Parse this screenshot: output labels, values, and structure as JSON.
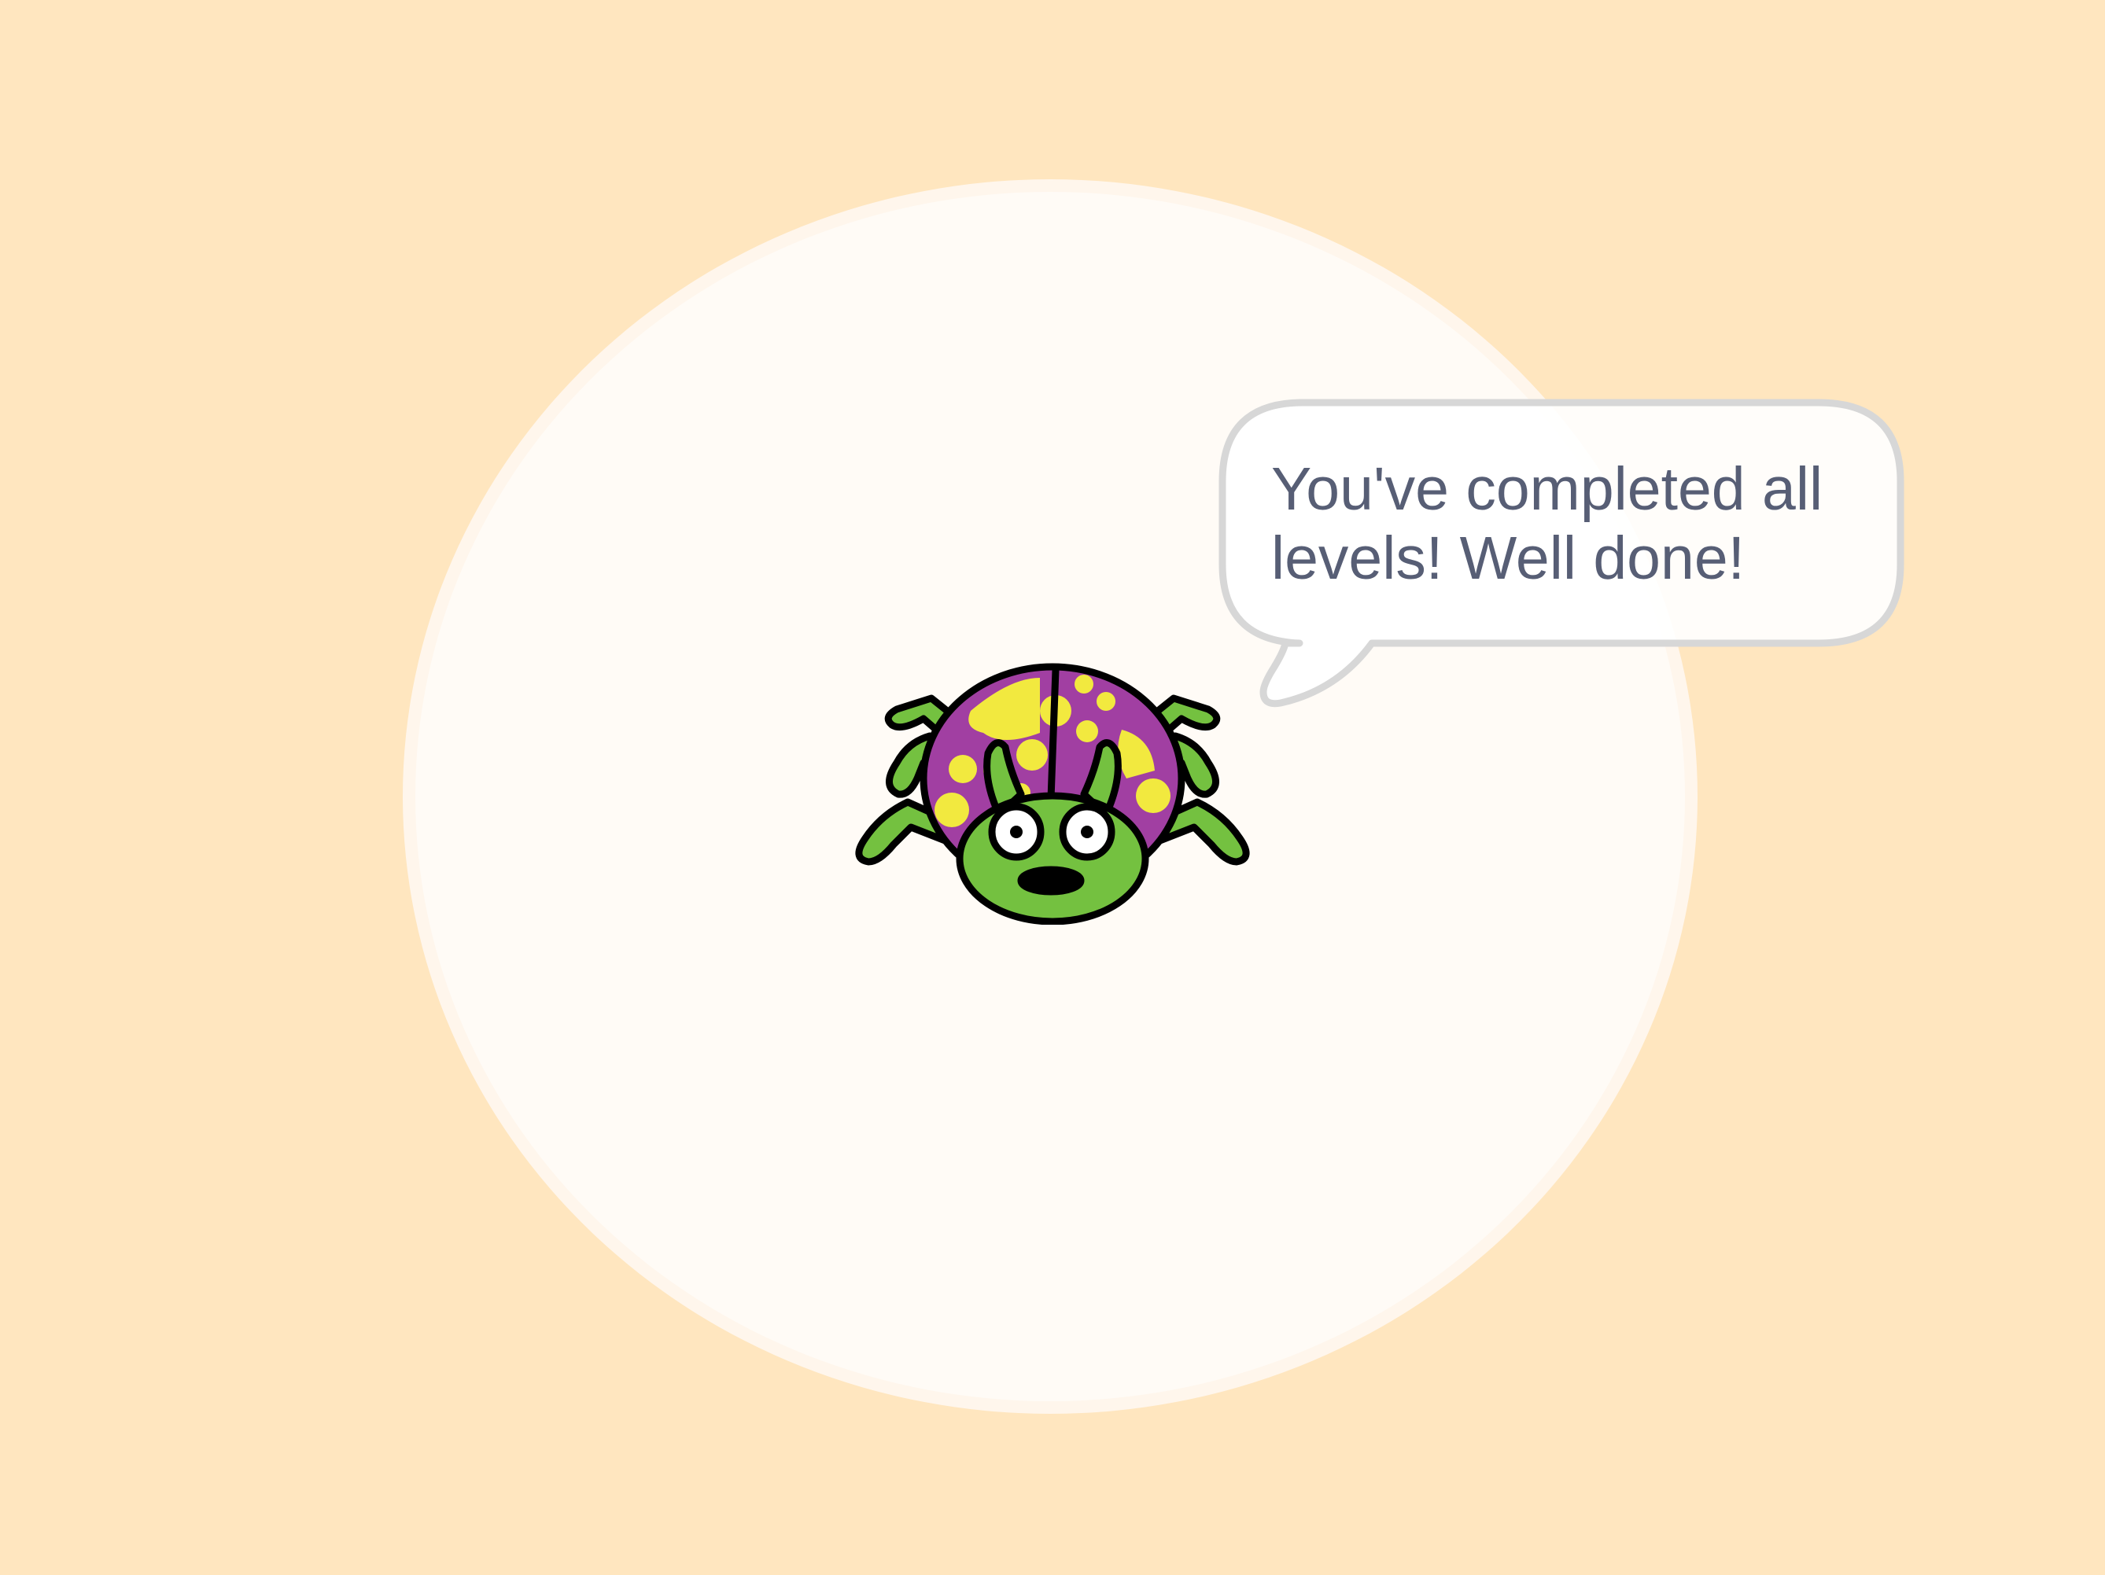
{
  "game": {
    "colors": {
      "background": "#ffe6bf",
      "arena_fill": "#fffbf6",
      "arena_border": "#fff6ec",
      "bubble_fill": "#ffffff",
      "bubble_border": "#d7d7d7",
      "bubble_text": "#575e75",
      "bug_body_green": "#74c140",
      "bug_shell_purple": "#a13fa2",
      "bug_spots_yellow": "#f2e93f",
      "outline": "#000000"
    },
    "character": {
      "icon": "ladybug-icon"
    },
    "speech_bubble": {
      "text": "You've completed all\nlevels! Well done!"
    }
  }
}
